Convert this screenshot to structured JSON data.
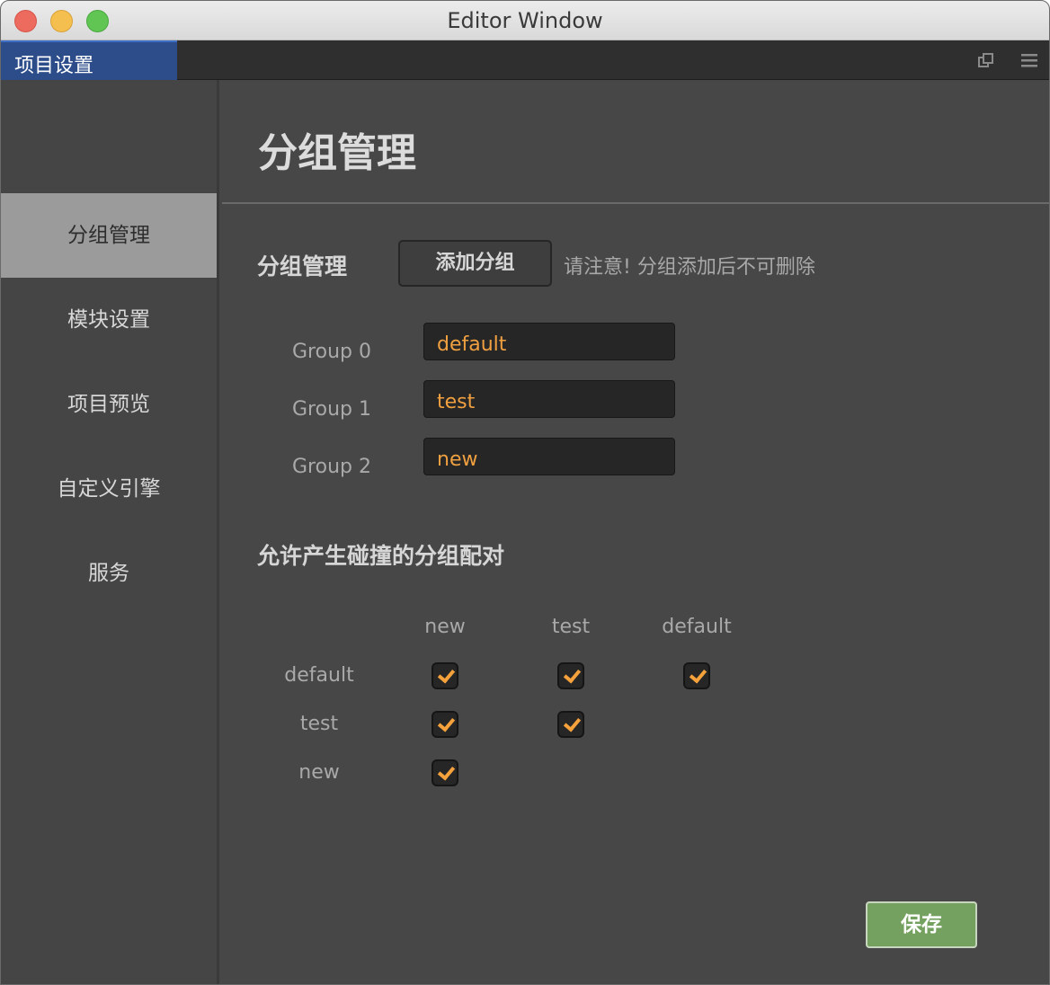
{
  "window": {
    "title": "Editor Window"
  },
  "tab": {
    "label": "项目设置"
  },
  "sidebar": {
    "items": [
      {
        "label": "分组管理",
        "active": true
      },
      {
        "label": "模块设置",
        "active": false
      },
      {
        "label": "项目预览",
        "active": false
      },
      {
        "label": "自定义引擎",
        "active": false
      },
      {
        "label": "服务",
        "active": false
      }
    ]
  },
  "main": {
    "title": "分组管理",
    "groups_section": {
      "label": "分组管理",
      "add_button": "添加分组",
      "notice": "请注意! 分组添加后不可删除",
      "groups": [
        {
          "label": "Group 0",
          "value": "default"
        },
        {
          "label": "Group 1",
          "value": "test"
        },
        {
          "label": "Group 2",
          "value": "new"
        }
      ]
    },
    "collision_section": {
      "label": "允许产生碰撞的分组配对",
      "columns": [
        "new",
        "test",
        "default"
      ],
      "rows": [
        {
          "label": "default",
          "checks": [
            true,
            true,
            true
          ]
        },
        {
          "label": "test",
          "checks": [
            true,
            true
          ]
        },
        {
          "label": "new",
          "checks": [
            true
          ]
        }
      ]
    },
    "save_button": "保存"
  },
  "colors": {
    "accent_tab": "#2c4d8a",
    "input_text": "#f0a040",
    "check": "#f5a13c",
    "save": "#74a15f"
  }
}
